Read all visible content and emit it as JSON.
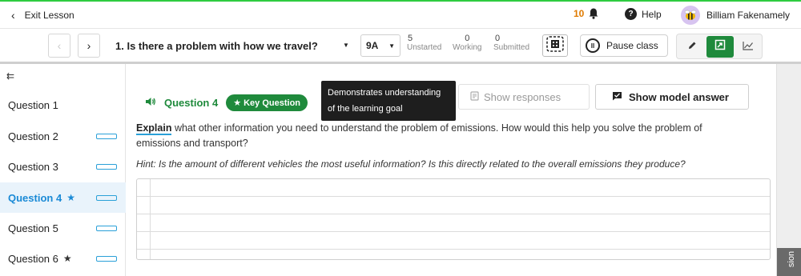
{
  "topbar": {
    "exit_label": "Exit Lesson",
    "notification_count": "10",
    "help_label": "Help",
    "user_name": "Billiam Fakenamely"
  },
  "toolbar": {
    "question_title": "1. Is there a problem with how we travel?",
    "class_selected": "9A",
    "stats": [
      {
        "count": "5",
        "label": "Unstarted"
      },
      {
        "count": "0",
        "label": "Working"
      },
      {
        "count": "0",
        "label": "Submitted"
      }
    ],
    "pause_label": "Pause class"
  },
  "sidebar": {
    "items": [
      {
        "label": "Question 1",
        "starred": false,
        "active": false
      },
      {
        "label": "Question 2",
        "starred": false,
        "active": false
      },
      {
        "label": "Question 3",
        "starred": false,
        "active": false
      },
      {
        "label": "Question 4",
        "starred": true,
        "active": true
      },
      {
        "label": "Question 5",
        "starred": false,
        "active": false
      },
      {
        "label": "Question 6",
        "starred": true,
        "active": false
      }
    ],
    "star_glyph": "★"
  },
  "main": {
    "question_label": "Question 4",
    "key_question_label": "★ Key Question",
    "tooltip_line1": "Demonstrates understanding",
    "tooltip_line2": "of the learning goal",
    "show_responses_label": "Show responses",
    "show_model_answer_label": "Show model answer",
    "prompt_command": "Explain",
    "prompt_text": " what other information you need to understand the problem of emissions. How would this help you solve the problem of emissions and transport?",
    "hint": "Hint: Is the amount of different vehicles the most useful information? Is this directly related to the overall emissions they produce?",
    "side_tab_label": "sion"
  },
  "colors": {
    "accent_green": "#1f8a3c",
    "accent_blue": "#1a8ad6",
    "top_border_green": "#2ecc40",
    "notification_orange": "#e07b00"
  },
  "icons": [
    "chevron-left-icon",
    "bell-icon",
    "question-circle-icon",
    "avatar-bee-icon",
    "chevron-right-icon",
    "caret-down-icon",
    "qr-code-icon",
    "pause-icon",
    "pencil-icon",
    "present-icon",
    "chart-icon",
    "collapse-left-icon",
    "speaker-icon",
    "document-icon",
    "flag-icon"
  ]
}
